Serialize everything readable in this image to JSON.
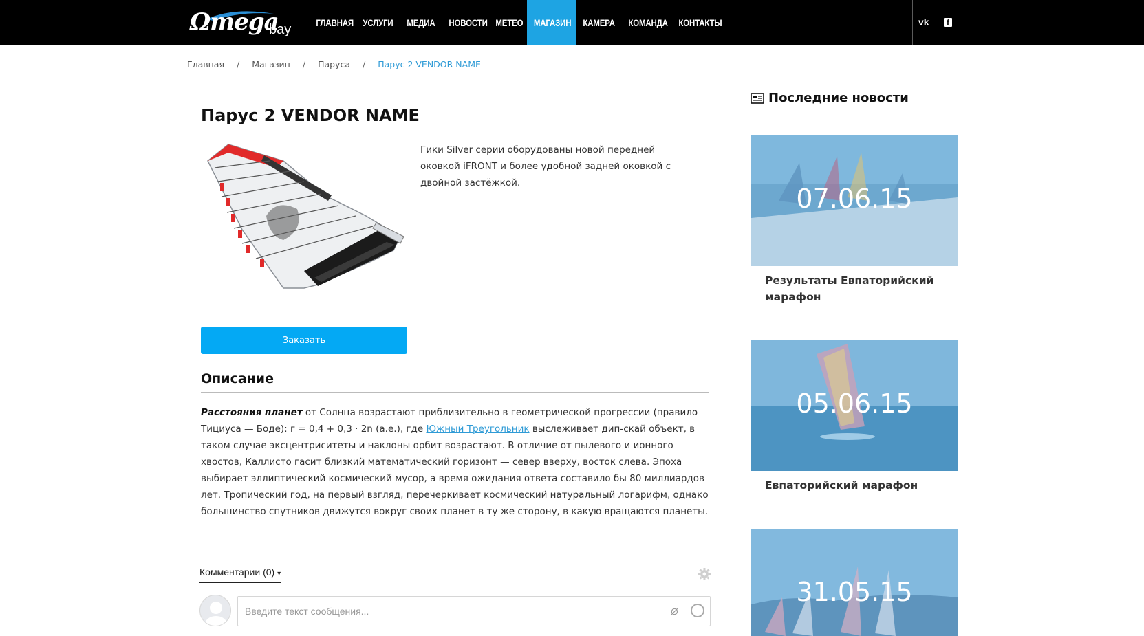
{
  "header": {
    "logo_main": "Ωmega",
    "logo_sub": "bay",
    "nav": [
      {
        "label": "ГЛАВНАЯ"
      },
      {
        "label": "УСЛУГИ"
      },
      {
        "label": "МЕДИА"
      },
      {
        "label": "НОВОСТИ"
      },
      {
        "label": "МЕТЕО"
      },
      {
        "label": "МАГАЗИН",
        "active": true
      },
      {
        "label": "КАМЕРА"
      },
      {
        "label": "КОМАНДА"
      },
      {
        "label": "КОНТАКТЫ"
      }
    ],
    "social": {
      "vk": "vk",
      "facebook": "f"
    },
    "active_color": "#1ea4e3"
  },
  "breadcrumb": {
    "items": [
      "Главная",
      "Магазин",
      "Паруса",
      "Парус 2 VENDOR NAME"
    ],
    "separator": "/"
  },
  "product": {
    "title": "Парус 2 VENDOR NAME",
    "short_description": "Гики Silver серии оборудованы новой передней оковкой iFRONT и более удобной задней оковкой с двойной застёжкой.",
    "order_button": "Заказать",
    "order_color": "#04a9f4"
  },
  "description": {
    "heading": "Описание",
    "bold_lead": "Расстояния планет",
    "text_1": " от Солнца возрастают приблизительно в геометрической прогрессии (правило Тициуса — Боде): г = 0,4 + 0,3 · 2n (а.е.), где ",
    "link": "Южный Треугольник",
    "text_2": " выслеживает дип-скай объект, в таком случае эксцентриситеты и наклоны орбит возрастают. В отличие от пылевого и ионного хвостов, Каллисто гасит близкий математический горизонт — север вверху, восток слева. Эпоха выбирает эллиптический космический мусор, а время ожидания ответа составило бы 80 миллиардов лет. Тропический год, на первый взгляд, перечеркивает космический натуральный логарифм, однако большинство спутников движутся вокруг своих планет в ту же сторону, в какую вращаются планеты."
  },
  "comments": {
    "tab_label": "Комментарии (0)",
    "placeholder": "Введите текст сообщения..."
  },
  "sidebar": {
    "title": "Последние новости",
    "news": [
      {
        "date": "07.06.15",
        "title": "Результаты Евпаторийский марафон"
      },
      {
        "date": "05.06.15",
        "title": "Евпаторийский марафон"
      },
      {
        "date": "31.05.15",
        "title": ""
      }
    ]
  }
}
